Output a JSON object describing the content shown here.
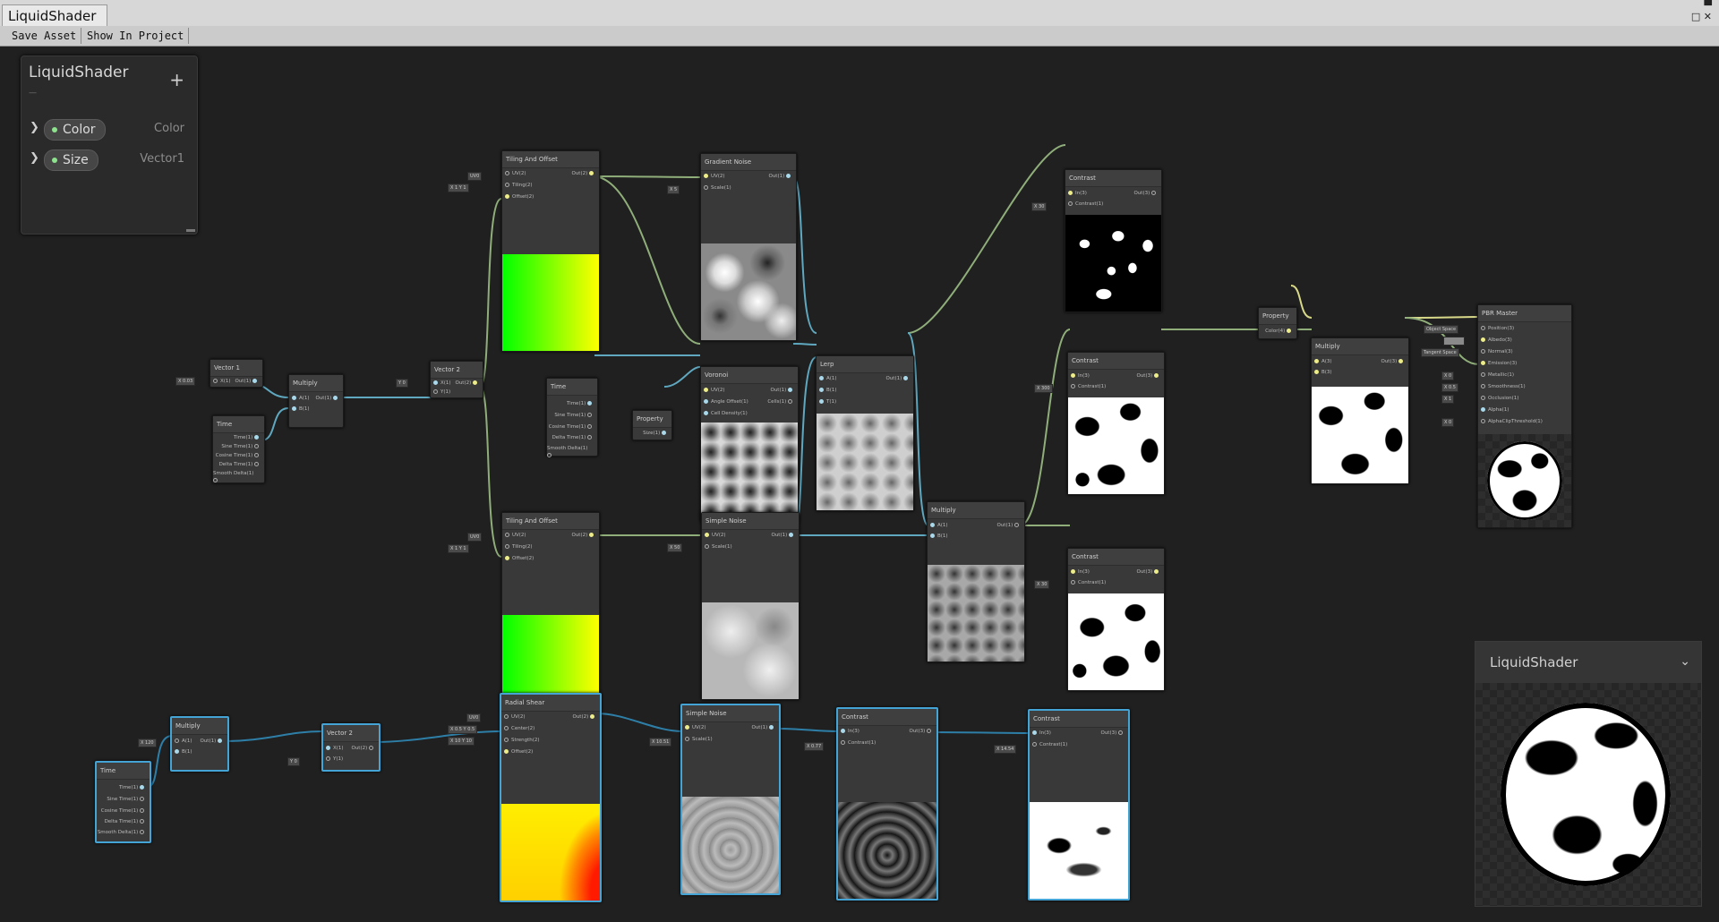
{
  "window": {
    "tab_title": "LiquidShader",
    "controls": {
      "minimize": "▀",
      "maximize": "□",
      "close": "✕"
    }
  },
  "toolbar": {
    "save_asset": "Save Asset",
    "show_in_project": "Show In Project"
  },
  "blackboard": {
    "title": "LiquidShader",
    "subtitle": "—",
    "add_label": "+",
    "properties": [
      {
        "name": "Color",
        "type": "Color"
      },
      {
        "name": "Size",
        "type": "Vector1"
      }
    ]
  },
  "master_preview": {
    "title": "LiquidShader"
  },
  "nodes": {
    "vector1": {
      "title": "Vector 1",
      "in": [
        "X(1)"
      ],
      "out": [
        "Out(1)"
      ],
      "val": "X 0.03"
    },
    "multiply_a": {
      "title": "Multiply",
      "in": [
        "A(1)",
        "B(1)"
      ],
      "out": [
        "Out(1)"
      ]
    },
    "time_a": {
      "title": "Time",
      "out": [
        "Time(1)",
        "Sine Time(1)",
        "Cosine Time(1)",
        "Delta Time(1)",
        "Smooth Delta(1)"
      ]
    },
    "vector2_a": {
      "title": "Vector 2",
      "in": [
        "X(1)",
        "Y(1)"
      ],
      "out": [
        "Out(2)"
      ],
      "val": "Y 0"
    },
    "tiling_a": {
      "title": "Tiling And Offset",
      "in": [
        "UV(2)",
        "Tiling(2)",
        "Offset(2)"
      ],
      "out": [
        "Out(2)"
      ],
      "vals": [
        "UV0",
        "X 1  Y 1"
      ]
    },
    "gradient_noise": {
      "title": "Gradient Noise",
      "in": [
        "UV(2)",
        "Scale(1)"
      ],
      "out": [
        "Out(1)"
      ],
      "val": "X 5"
    },
    "time_b": {
      "title": "Time",
      "out": [
        "Time(1)",
        "Sine Time(1)",
        "Cosine Time(1)",
        "Delta Time(1)",
        "Smooth Delta(1)"
      ]
    },
    "property_size": {
      "title": "Property",
      "out": [
        "Size(1)"
      ]
    },
    "voronoi": {
      "title": "Voronoi",
      "in": [
        "UV(2)",
        "Angle Offset(1)",
        "Cell Density(1)"
      ],
      "out": [
        "Out(1)",
        "Cells(1)"
      ]
    },
    "lerp": {
      "title": "Lerp",
      "in": [
        "A(1)",
        "B(1)",
        "T(1)"
      ],
      "out": [
        "Out(1)"
      ]
    },
    "contrast_1": {
      "title": "Contrast",
      "in": [
        "In(3)",
        "Contrast(1)"
      ],
      "out": [
        "Out(3)"
      ],
      "val": "X 30"
    },
    "contrast_2": {
      "title": "Contrast",
      "in": [
        "In(3)",
        "Contrast(1)"
      ],
      "out": [
        "Out(3)"
      ],
      "val": "X 300"
    },
    "contrast_3": {
      "title": "Contrast",
      "in": [
        "In(3)",
        "Contrast(1)"
      ],
      "out": [
        "Out(3)"
      ],
      "val": "X 30"
    },
    "property_color": {
      "title": "Property",
      "out": [
        "Color(4)"
      ]
    },
    "multiply_b": {
      "title": "Multiply",
      "in": [
        "A(3)",
        "B(3)"
      ],
      "out": [
        "Out(3)"
      ]
    },
    "pbr_master": {
      "title": "PBR Master",
      "in": [
        "Position(3)",
        "Albedo(3)",
        "Normal(3)",
        "Emission(3)",
        "Metallic(1)",
        "Smoothness(1)",
        "Occlusion(1)",
        "Alpha(1)",
        "AlphaClipThreshold(1)"
      ],
      "vals": [
        "Object Space",
        "",
        "Tangent Space",
        "",
        "X 0",
        "X 0.5",
        "X 1",
        "",
        "X 0"
      ]
    },
    "tiling_b": {
      "title": "Tiling And Offset",
      "in": [
        "UV(2)",
        "Tiling(2)",
        "Offset(2)"
      ],
      "out": [
        "Out(2)"
      ],
      "vals": [
        "UV0",
        "X 1  Y 1"
      ]
    },
    "simple_noise_a": {
      "title": "Simple Noise",
      "in": [
        "UV(2)",
        "Scale(1)"
      ],
      "out": [
        "Out(1)"
      ],
      "val": "X 50"
    },
    "multiply_c": {
      "title": "Multiply",
      "in": [
        "A(1)",
        "B(1)"
      ],
      "out": [
        "Out(1)"
      ]
    },
    "time_c": {
      "title": "Time",
      "out": [
        "Time(1)",
        "Sine Time(1)",
        "Cosine Time(1)",
        "Delta Time(1)",
        "Smooth Delta(1)"
      ]
    },
    "multiply_d": {
      "title": "Multiply",
      "in": [
        "A(1)",
        "B(1)"
      ],
      "out": [
        "Out(1)"
      ],
      "val": "X 120"
    },
    "vector2_b": {
      "title": "Vector 2",
      "in": [
        "X(1)",
        "Y(1)"
      ],
      "out": [
        "Out(2)"
      ],
      "val": "Y 0"
    },
    "radial_shear": {
      "title": "Radial Shear",
      "in": [
        "UV(2)",
        "Center(2)",
        "Strength(2)",
        "Offset(2)"
      ],
      "out": [
        "Out(2)"
      ],
      "vals": [
        "UV0",
        "X 0.5  Y 0.5",
        "X 10  Y 10"
      ]
    },
    "simple_noise_b": {
      "title": "Simple Noise",
      "in": [
        "UV(2)",
        "Scale(1)"
      ],
      "out": [
        "Out(1)"
      ],
      "val": "X 10.51"
    },
    "contrast_4": {
      "title": "Contrast",
      "in": [
        "In(3)",
        "Contrast(1)"
      ],
      "out": [
        "Out(3)"
      ],
      "val": "X 0.77"
    },
    "contrast_5": {
      "title": "Contrast",
      "in": [
        "In(3)",
        "Contrast(1)"
      ],
      "out": [
        "Out(3)"
      ],
      "val": "X 14.54"
    }
  }
}
